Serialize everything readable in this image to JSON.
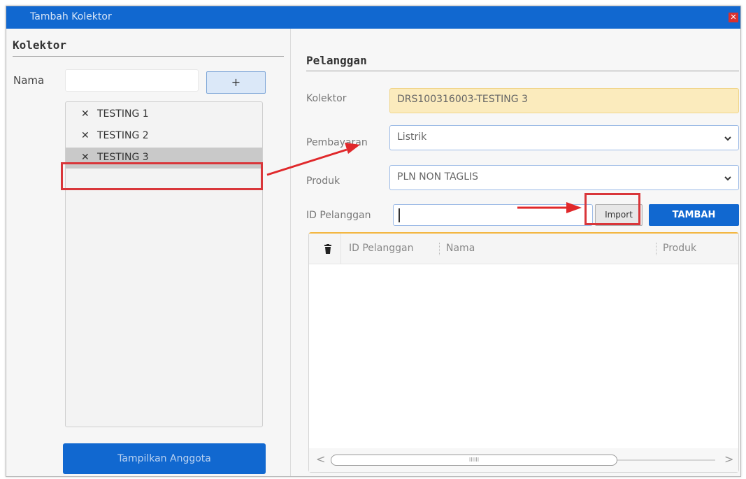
{
  "window": {
    "title": "Tambah Kolektor",
    "close_glyph": "✕"
  },
  "kolektor_panel": {
    "heading": "Kolektor",
    "nama_label": "Nama",
    "nama_value": "",
    "add_button_label": "+",
    "items": [
      {
        "label": "TESTING 1",
        "remove_glyph": "✕",
        "selected": false
      },
      {
        "label": "TESTING 2",
        "remove_glyph": "✕",
        "selected": false
      },
      {
        "label": "TESTING 3",
        "remove_glyph": "✕",
        "selected": true
      }
    ],
    "show_members_button": "Tampilkan Anggota"
  },
  "pelanggan_panel": {
    "heading": "Pelanggan",
    "kolektor_label": "Kolektor",
    "kolektor_value": "DRS100316003-TESTING 3",
    "pembayaran_label": "Pembayaran",
    "pembayaran_value": "Listrik",
    "produk_label": "Produk",
    "produk_value": "PLN NON TAGLIS",
    "id_label": "ID Pelanggan",
    "id_value": "",
    "import_button": "Import",
    "tambah_button": "TAMBAH",
    "table": {
      "delete_icon": "trash-icon",
      "columns": [
        "ID Pelanggan",
        "Nama",
        "Produk"
      ],
      "rows": [],
      "scroll_thumb_glyph": "IIIIII",
      "scroll_left_glyph": "<",
      "scroll_right_glyph": ">"
    }
  },
  "colors": {
    "titlebar": "#1168d0",
    "annotation_red": "#d9363a",
    "kolektor_field_bg": "#fbebbd",
    "grid_accent": "#f3b640"
  }
}
